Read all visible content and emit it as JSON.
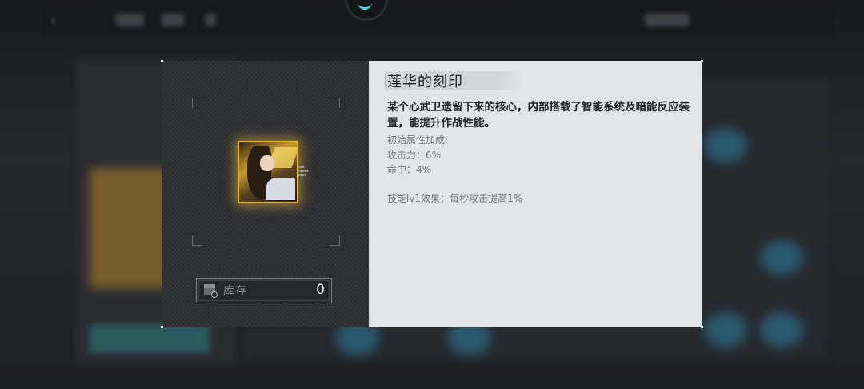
{
  "item": {
    "name": "莲华的刻印",
    "description": "某个心武卫遗留下来的核心，内部搭载了智能系统及暗能反应装置，能提升作战性能。",
    "attributes_header": "初始属性加成:",
    "attributes": [
      "攻击力：6%",
      "命中：4%"
    ],
    "skill": "技能lv1效果：每秒攻击提高1%"
  },
  "stock": {
    "label": "库存",
    "count": "0"
  },
  "icons": {
    "back": "chevron-left-icon",
    "stock": "box-search-icon"
  },
  "colors": {
    "rarity_gold": "#e8b83a",
    "panel_dark": "#2c2d30",
    "panel_light": "#e3e4e6",
    "accent_cyan": "#4fd4e6"
  }
}
